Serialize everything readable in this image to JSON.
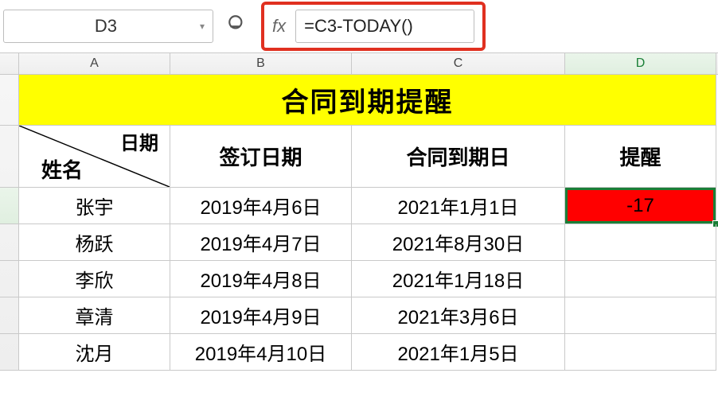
{
  "toolbar": {
    "name_box": "D3",
    "formula": "=C3-TODAY()",
    "fx_label": "fx"
  },
  "search_icon": "⦿",
  "columns": [
    "A",
    "B",
    "C",
    "D"
  ],
  "title_row": "合同到期提醒",
  "header_row": {
    "a_top": "日期",
    "a_bottom": "姓名",
    "b": "签订日期",
    "c": "合同到期日",
    "d": "提醒"
  },
  "rows": [
    {
      "name": "张宇",
      "sign": "2019年4月6日",
      "due": "2021年1月1日",
      "remind": "-17"
    },
    {
      "name": "杨跃",
      "sign": "2019年4月7日",
      "due": "2021年8月30日",
      "remind": ""
    },
    {
      "name": "李欣",
      "sign": "2019年4月8日",
      "due": "2021年1月18日",
      "remind": ""
    },
    {
      "name": "章清",
      "sign": "2019年4月9日",
      "due": "2021年3月6日",
      "remind": ""
    },
    {
      "name": "沈月",
      "sign": "2019年4月10日",
      "due": "2021年1月5日",
      "remind": ""
    }
  ],
  "colors": {
    "title_bg": "#ffff00",
    "alert_bg": "#ff0000",
    "selection": "#1a7f37",
    "callout": "#e03020"
  },
  "selected_cell": "D3"
}
